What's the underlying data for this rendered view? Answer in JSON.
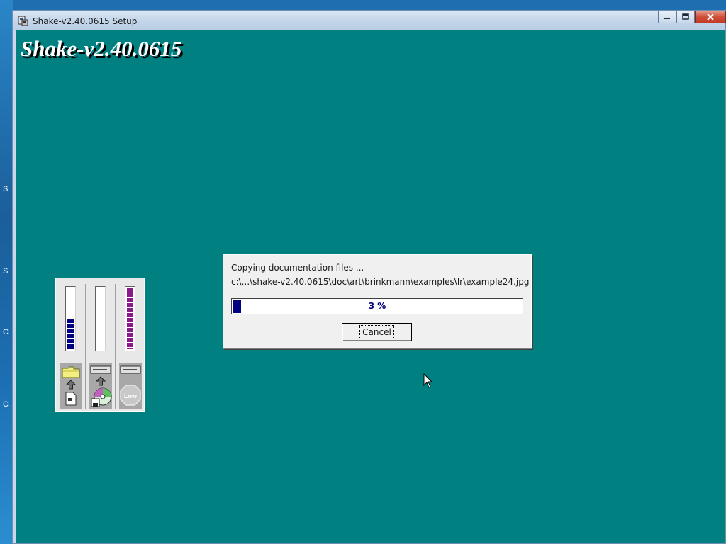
{
  "window": {
    "title": "Shake-v2.40.0615 Setup",
    "banner": "Shake-v2.40.0615"
  },
  "desktop_edge_fragments": [
    "S",
    "S",
    "C",
    "C"
  ],
  "dialog": {
    "status": "Copying documentation files ...",
    "path": "c:\\...\\shake-v2.40.0615\\doc\\art\\brinkmann\\examples\\lr\\example24.jpg",
    "progress_percent": 3,
    "progress_label": "3 %",
    "cancel_label": "Cancel"
  },
  "meters": {
    "columns": [
      {
        "name": "destination-disk",
        "fill_fraction": 0.5,
        "color": "#000080",
        "icons": [
          "folder-icon",
          "arrow-up-icon",
          "document-icon"
        ]
      },
      {
        "name": "source-disk",
        "fill_fraction": 0.0,
        "color": "#000080",
        "icons": [
          "drive-icon",
          "arrow-up-icon",
          "cd-disk-icon"
        ]
      },
      {
        "name": "memory",
        "fill_fraction": 1.0,
        "color": "#8a1a8a",
        "icons": [
          "drive-icon",
          "low-badge-icon"
        ]
      }
    ],
    "low_label": "Low"
  },
  "colors": {
    "client_background": "#008080",
    "progress_fill": "#000080",
    "memory_meter": "#8a1a8a"
  }
}
